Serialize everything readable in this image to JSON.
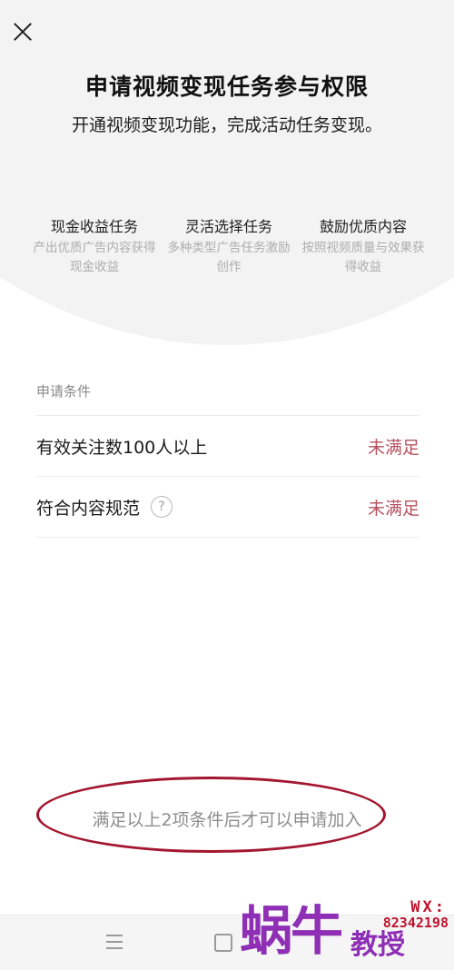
{
  "header": {
    "close_icon": "close-icon",
    "title": "申请视频变现任务参与权限",
    "subtitle": "开通视频变现功能，完成活动任务变现。"
  },
  "features": [
    {
      "title": "现金收益任务",
      "desc": "产出优质广告内容获得现金收益"
    },
    {
      "title": "灵活选择任务",
      "desc": "多种类型广告任务激励创作"
    },
    {
      "title": "鼓励优质内容",
      "desc": "按照视频质量与效果获得收益"
    }
  ],
  "conditions": {
    "label": "申请条件",
    "items": [
      {
        "text": "有效关注数100人以上",
        "status": "未满足"
      },
      {
        "text": "符合内容规范",
        "help_icon": "?",
        "status": "未满足"
      }
    ]
  },
  "footer_note": "满足以上2项条件后才可以申请加入",
  "navbar": {
    "menu_icon": "menu-icon",
    "home_icon": "home-icon"
  },
  "watermark": {
    "big_text": "蜗牛",
    "small_text": "教授",
    "wx_label": "WX:",
    "wx_number": "82342198"
  },
  "colors": {
    "status_red": "#b5515f",
    "annotation_red": "#a3162f",
    "watermark_purple": "#8e2fb5"
  }
}
